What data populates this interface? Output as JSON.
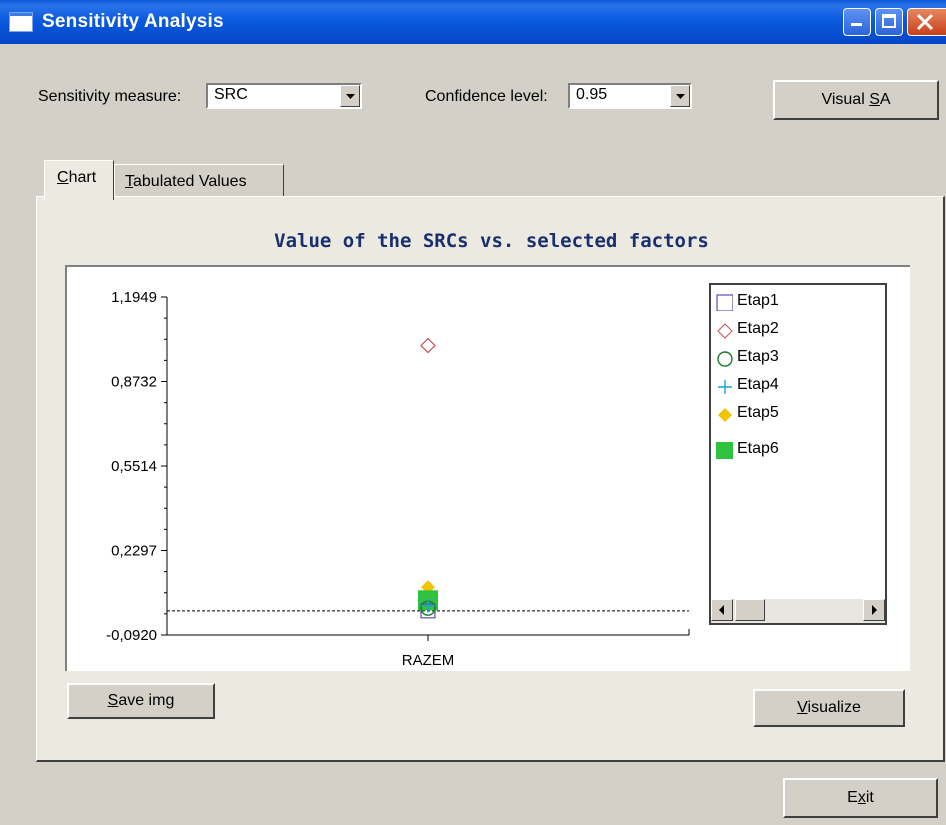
{
  "window": {
    "title": "Sensitivity Analysis"
  },
  "controls": {
    "sensitivity_label": "Sensitivity measure:",
    "sensitivity_value": "SRC",
    "confidence_label": "Confidence level:",
    "confidence_value": "0.95",
    "visual_sa_label": "Visual SA",
    "visual_sa_mnemonic": "S"
  },
  "tabs": [
    {
      "label": "Chart",
      "mnemonic": "C",
      "active": true
    },
    {
      "label": "Tabulated Values",
      "mnemonic": "T",
      "active": false
    }
  ],
  "buttons": {
    "save_img": "Save img",
    "save_img_mnemonic": "S",
    "visualize": "Visualize",
    "visualize_mnemonic": "V",
    "exit": "Exit",
    "exit_mnemonic": "x"
  },
  "chart_data": {
    "type": "scatter",
    "title": "Value of the SRCs vs. selected factors",
    "categories": [
      "RAZEM"
    ],
    "yticks": [
      "1,1949",
      "0,8732",
      "0,5514",
      "0,2297",
      "-0,0920"
    ],
    "ylim": [
      -0.092,
      1.1949
    ],
    "reference_line": 0,
    "legend_position": "right",
    "series": [
      {
        "name": "Etap1",
        "marker": "square-open",
        "color": "#5a4fb0",
        "values": [
          0.0
        ]
      },
      {
        "name": "Etap2",
        "marker": "diamond-open",
        "color": "#c85050",
        "values": [
          1.01
        ]
      },
      {
        "name": "Etap3",
        "marker": "circle-open",
        "color": "#1a7a2a",
        "values": [
          0.01
        ]
      },
      {
        "name": "Etap4",
        "marker": "plus",
        "color": "#1fa0d0",
        "values": [
          0.02
        ]
      },
      {
        "name": "Etap5",
        "marker": "diamond-filled",
        "color": "#f0c400",
        "values": [
          0.09
        ]
      },
      {
        "name": "Etap6",
        "marker": "square-filled",
        "color": "#2ec23e",
        "values": [
          0.04
        ]
      }
    ]
  }
}
